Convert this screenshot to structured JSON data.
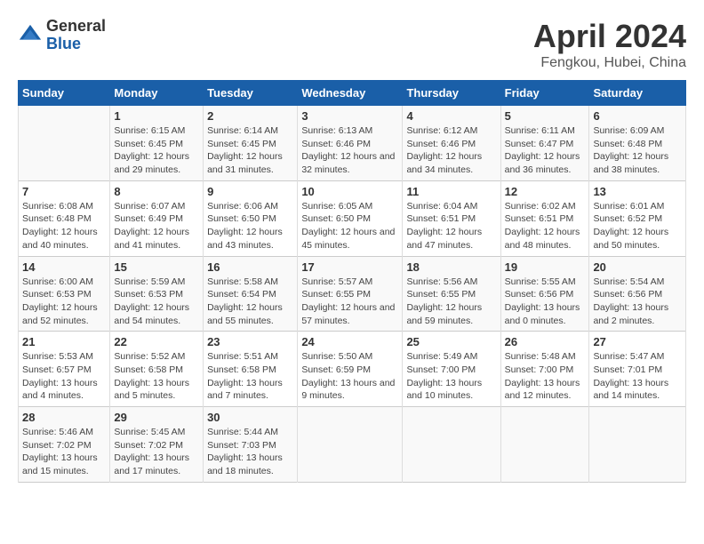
{
  "header": {
    "logo_general": "General",
    "logo_blue": "Blue",
    "title": "April 2024",
    "subtitle": "Fengkou, Hubei, China"
  },
  "calendar": {
    "days_of_week": [
      "Sunday",
      "Monday",
      "Tuesday",
      "Wednesday",
      "Thursday",
      "Friday",
      "Saturday"
    ],
    "weeks": [
      [
        {
          "day": "",
          "sunrise": "",
          "sunset": "",
          "daylight": ""
        },
        {
          "day": "1",
          "sunrise": "Sunrise: 6:15 AM",
          "sunset": "Sunset: 6:45 PM",
          "daylight": "Daylight: 12 hours and 29 minutes."
        },
        {
          "day": "2",
          "sunrise": "Sunrise: 6:14 AM",
          "sunset": "Sunset: 6:45 PM",
          "daylight": "Daylight: 12 hours and 31 minutes."
        },
        {
          "day": "3",
          "sunrise": "Sunrise: 6:13 AM",
          "sunset": "Sunset: 6:46 PM",
          "daylight": "Daylight: 12 hours and 32 minutes."
        },
        {
          "day": "4",
          "sunrise": "Sunrise: 6:12 AM",
          "sunset": "Sunset: 6:46 PM",
          "daylight": "Daylight: 12 hours and 34 minutes."
        },
        {
          "day": "5",
          "sunrise": "Sunrise: 6:11 AM",
          "sunset": "Sunset: 6:47 PM",
          "daylight": "Daylight: 12 hours and 36 minutes."
        },
        {
          "day": "6",
          "sunrise": "Sunrise: 6:09 AM",
          "sunset": "Sunset: 6:48 PM",
          "daylight": "Daylight: 12 hours and 38 minutes."
        }
      ],
      [
        {
          "day": "7",
          "sunrise": "Sunrise: 6:08 AM",
          "sunset": "Sunset: 6:48 PM",
          "daylight": "Daylight: 12 hours and 40 minutes."
        },
        {
          "day": "8",
          "sunrise": "Sunrise: 6:07 AM",
          "sunset": "Sunset: 6:49 PM",
          "daylight": "Daylight: 12 hours and 41 minutes."
        },
        {
          "day": "9",
          "sunrise": "Sunrise: 6:06 AM",
          "sunset": "Sunset: 6:50 PM",
          "daylight": "Daylight: 12 hours and 43 minutes."
        },
        {
          "day": "10",
          "sunrise": "Sunrise: 6:05 AM",
          "sunset": "Sunset: 6:50 PM",
          "daylight": "Daylight: 12 hours and 45 minutes."
        },
        {
          "day": "11",
          "sunrise": "Sunrise: 6:04 AM",
          "sunset": "Sunset: 6:51 PM",
          "daylight": "Daylight: 12 hours and 47 minutes."
        },
        {
          "day": "12",
          "sunrise": "Sunrise: 6:02 AM",
          "sunset": "Sunset: 6:51 PM",
          "daylight": "Daylight: 12 hours and 48 minutes."
        },
        {
          "day": "13",
          "sunrise": "Sunrise: 6:01 AM",
          "sunset": "Sunset: 6:52 PM",
          "daylight": "Daylight: 12 hours and 50 minutes."
        }
      ],
      [
        {
          "day": "14",
          "sunrise": "Sunrise: 6:00 AM",
          "sunset": "Sunset: 6:53 PM",
          "daylight": "Daylight: 12 hours and 52 minutes."
        },
        {
          "day": "15",
          "sunrise": "Sunrise: 5:59 AM",
          "sunset": "Sunset: 6:53 PM",
          "daylight": "Daylight: 12 hours and 54 minutes."
        },
        {
          "day": "16",
          "sunrise": "Sunrise: 5:58 AM",
          "sunset": "Sunset: 6:54 PM",
          "daylight": "Daylight: 12 hours and 55 minutes."
        },
        {
          "day": "17",
          "sunrise": "Sunrise: 5:57 AM",
          "sunset": "Sunset: 6:55 PM",
          "daylight": "Daylight: 12 hours and 57 minutes."
        },
        {
          "day": "18",
          "sunrise": "Sunrise: 5:56 AM",
          "sunset": "Sunset: 6:55 PM",
          "daylight": "Daylight: 12 hours and 59 minutes."
        },
        {
          "day": "19",
          "sunrise": "Sunrise: 5:55 AM",
          "sunset": "Sunset: 6:56 PM",
          "daylight": "Daylight: 13 hours and 0 minutes."
        },
        {
          "day": "20",
          "sunrise": "Sunrise: 5:54 AM",
          "sunset": "Sunset: 6:56 PM",
          "daylight": "Daylight: 13 hours and 2 minutes."
        }
      ],
      [
        {
          "day": "21",
          "sunrise": "Sunrise: 5:53 AM",
          "sunset": "Sunset: 6:57 PM",
          "daylight": "Daylight: 13 hours and 4 minutes."
        },
        {
          "day": "22",
          "sunrise": "Sunrise: 5:52 AM",
          "sunset": "Sunset: 6:58 PM",
          "daylight": "Daylight: 13 hours and 5 minutes."
        },
        {
          "day": "23",
          "sunrise": "Sunrise: 5:51 AM",
          "sunset": "Sunset: 6:58 PM",
          "daylight": "Daylight: 13 hours and 7 minutes."
        },
        {
          "day": "24",
          "sunrise": "Sunrise: 5:50 AM",
          "sunset": "Sunset: 6:59 PM",
          "daylight": "Daylight: 13 hours and 9 minutes."
        },
        {
          "day": "25",
          "sunrise": "Sunrise: 5:49 AM",
          "sunset": "Sunset: 7:00 PM",
          "daylight": "Daylight: 13 hours and 10 minutes."
        },
        {
          "day": "26",
          "sunrise": "Sunrise: 5:48 AM",
          "sunset": "Sunset: 7:00 PM",
          "daylight": "Daylight: 13 hours and 12 minutes."
        },
        {
          "day": "27",
          "sunrise": "Sunrise: 5:47 AM",
          "sunset": "Sunset: 7:01 PM",
          "daylight": "Daylight: 13 hours and 14 minutes."
        }
      ],
      [
        {
          "day": "28",
          "sunrise": "Sunrise: 5:46 AM",
          "sunset": "Sunset: 7:02 PM",
          "daylight": "Daylight: 13 hours and 15 minutes."
        },
        {
          "day": "29",
          "sunrise": "Sunrise: 5:45 AM",
          "sunset": "Sunset: 7:02 PM",
          "daylight": "Daylight: 13 hours and 17 minutes."
        },
        {
          "day": "30",
          "sunrise": "Sunrise: 5:44 AM",
          "sunset": "Sunset: 7:03 PM",
          "daylight": "Daylight: 13 hours and 18 minutes."
        },
        {
          "day": "",
          "sunrise": "",
          "sunset": "",
          "daylight": ""
        },
        {
          "day": "",
          "sunrise": "",
          "sunset": "",
          "daylight": ""
        },
        {
          "day": "",
          "sunrise": "",
          "sunset": "",
          "daylight": ""
        },
        {
          "day": "",
          "sunrise": "",
          "sunset": "",
          "daylight": ""
        }
      ]
    ]
  }
}
